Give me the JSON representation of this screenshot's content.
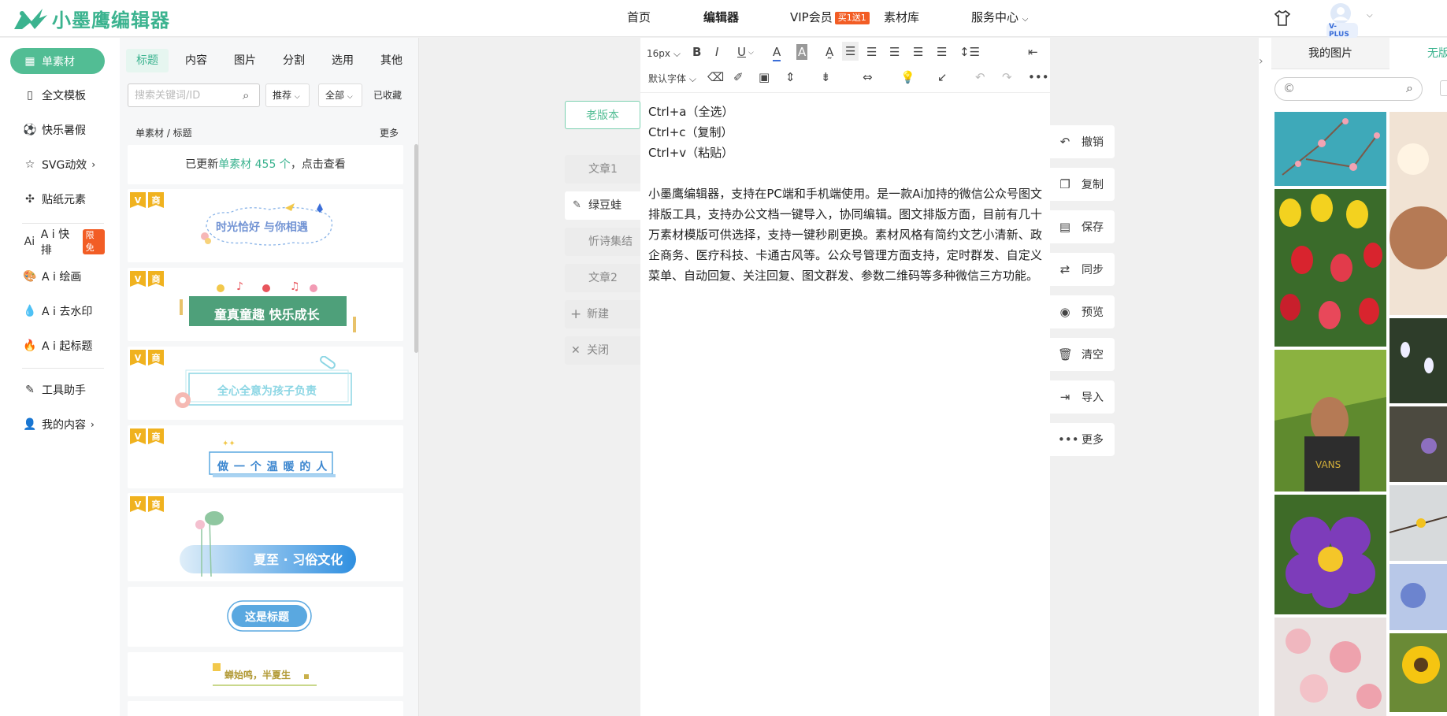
{
  "header": {
    "logo_text": "小墨鹰编辑器",
    "nav": [
      "首页",
      "编辑器",
      "VIP会员",
      "素材库",
      "服务中心"
    ],
    "vip_badge": "买1送1",
    "avatar_badge": "V-PLUS"
  },
  "rail": {
    "items": [
      "单素材",
      "全文模板",
      "快乐暑假",
      "SVG动效",
      "贴纸元素",
      "A i 快排",
      "A i 绘画",
      "A i 去水印",
      "A i 起标题",
      "工具助手",
      "我的内容"
    ],
    "free_badge": "限免"
  },
  "panel": {
    "tabs": [
      "标题",
      "内容",
      "图片",
      "分割",
      "选用",
      "其他"
    ],
    "search_placeholder": "搜索关键词/ID",
    "filters": [
      "推荐",
      "全部"
    ],
    "collected": "已收藏",
    "crumb": "单素材 / 标题",
    "more": "更多",
    "update_prefix": "已更新",
    "update_link": "单素材 455 个",
    "update_suffix": "，点击查看",
    "tags": [
      "V",
      "商"
    ],
    "cards": [
      "时光恰好 与你相遇",
      "童真童趣 快乐成长",
      "全心全意为孩子负责",
      "做 一 个 温 暖 的 人",
      "夏至 · 习俗文化",
      "这是标题",
      "蝉始鸣，半夏生"
    ]
  },
  "versions": {
    "old": "老版本",
    "items": [
      "文章1",
      "绿豆蛙",
      "忻诗集结",
      "文章2",
      "新建",
      "关闭"
    ]
  },
  "editor": {
    "font_size": "16px",
    "font_family": "默认字体",
    "lines": [
      "Ctrl+a（全选）",
      "Ctrl+c（复制）",
      "Ctrl+v（粘贴）",
      "",
      "小墨鹰编辑器，支持在PC端和手机端使用。是一款Ai加持的微信公众号图文排版工具，支持办公文档一键导入，协同编辑。图文排版方面，目前有几十万素材模版可供选择，支持一键秒刷更换。素材风格有简约文艺小清新、政企商务、医疗科技、卡通古风等。公众号管理方面支持，定时群发、自定义菜单、自动回复、关注回复、图文群发、参数二维码等多种微信三方功能。"
    ]
  },
  "actions": [
    "撤销",
    "复制",
    "保存",
    "同步",
    "预览",
    "清空",
    "导入",
    "更多"
  ],
  "right": {
    "tab_mine": "我的图片",
    "tab_free": "无版权图片",
    "search_value": "©"
  }
}
